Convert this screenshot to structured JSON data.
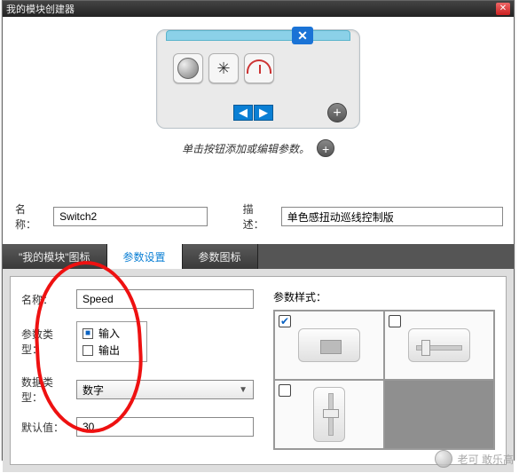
{
  "window": {
    "title": "我的模块创建器"
  },
  "block": {
    "hint": "单击按钮添加或编辑参数。"
  },
  "fields": {
    "name_label": "名称：",
    "name_value": "Switch2",
    "desc_label": "描述：",
    "desc_value": "单色感扭动巡线控制版"
  },
  "tabs": {
    "t1": "\"我的模块\"图标",
    "t2": "参数设置",
    "t3": "参数图标"
  },
  "param": {
    "name_label": "名称：",
    "name_value": "Speed",
    "type_label": "参数类型：",
    "type_input": "输入",
    "type_output": "输出",
    "datatype_label": "数据类型：",
    "datatype_value": "数字",
    "default_label": "默认值：",
    "default_value": "30",
    "style_label": "参数样式："
  },
  "watermark": "老可 敢乐高"
}
